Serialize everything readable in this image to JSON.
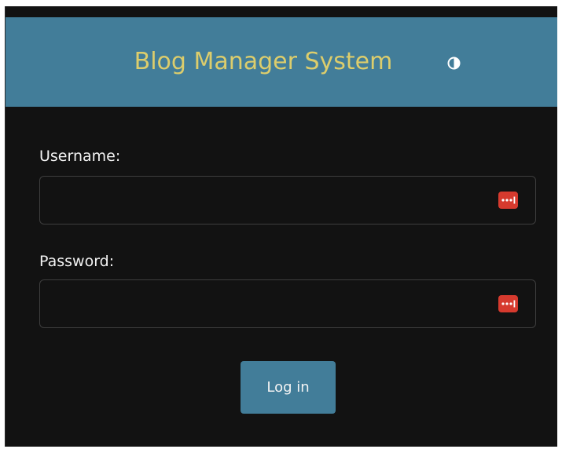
{
  "header": {
    "title": "Blog Manager System",
    "theme_toggle_icon": "contrast-icon"
  },
  "form": {
    "username_label": "Username:",
    "username_value": "",
    "password_label": "Password:",
    "password_value": "",
    "password_manager_icon": "password-manager-icon",
    "submit_label": "Log in"
  },
  "colors": {
    "header_bg": "#427d99",
    "title_text": "#dccd6c",
    "page_bg": "#121212",
    "button_bg": "#427d99",
    "password_manager_icon": "#d63a2e"
  }
}
